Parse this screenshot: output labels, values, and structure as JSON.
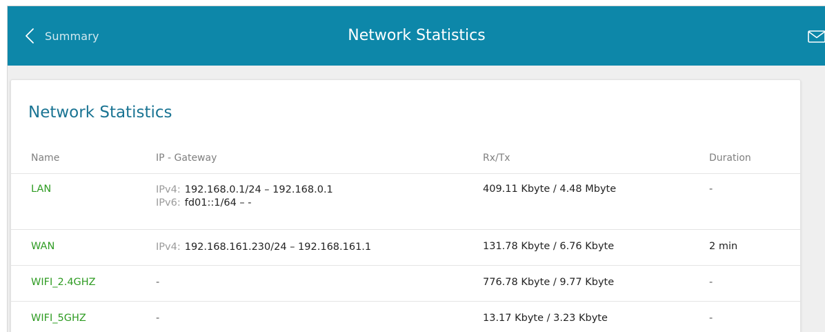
{
  "header": {
    "back_label": "Summary",
    "title": "Network Statistics",
    "icons": {
      "back": "chevron-left-icon",
      "notifications": "mail-icon"
    },
    "background_color": "#0d87a9"
  },
  "card": {
    "title": "Network Statistics"
  },
  "table": {
    "columns": {
      "name": "Name",
      "ip_gateway": "IP - Gateway",
      "rx_tx": "Rx/Tx",
      "duration": "Duration"
    },
    "rows": [
      {
        "name": "LAN",
        "ipv4_label": "IPv4:",
        "ipv4": "192.168.0.1/24 – 192.168.0.1",
        "ipv6_label": "IPv6:",
        "ipv6": "fd01::1/64 – -",
        "rx_tx": "409.11 Kbyte / 4.48 Mbyte",
        "duration": "-"
      },
      {
        "name": "WAN",
        "ipv4_label": "IPv4:",
        "ipv4": "192.168.161.230/24 – 192.168.161.1",
        "rx_tx": "131.78 Kbyte / 6.76 Kbyte",
        "duration": "2 min"
      },
      {
        "name": "WIFI_2.4GHZ",
        "ip_gateway": "-",
        "rx_tx": "776.78 Kbyte / 9.77 Kbyte",
        "duration": "-"
      },
      {
        "name": "WIFI_5GHZ",
        "ip_gateway": "-",
        "rx_tx": "13.17 Kbyte / 3.23 Kbyte",
        "duration": "-"
      }
    ]
  },
  "colors": {
    "accent": "#1a7493",
    "link": "#2e9b22"
  }
}
